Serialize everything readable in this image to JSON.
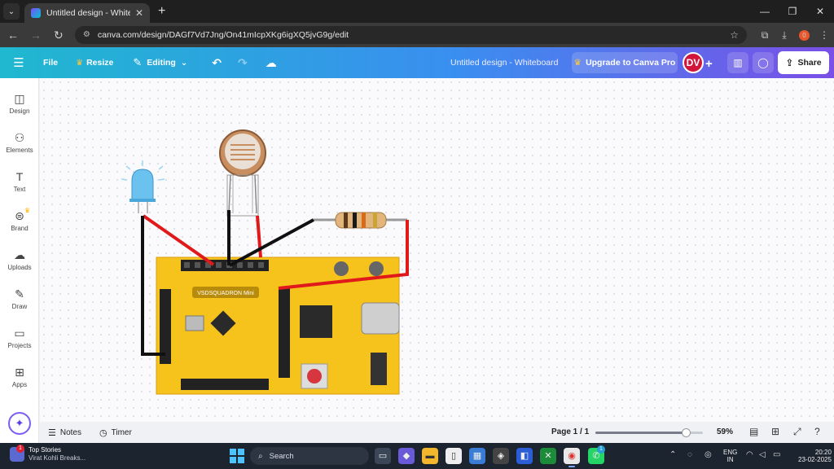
{
  "browser": {
    "tab_title": "Untitled design - Whiteboard",
    "tab_close": "✕",
    "new_tab": "+",
    "url": "canva.com/design/DAGf7Vd7Jng/On41mIcpXKg6igXQ5jvG9g/edit",
    "profile_initial": "0"
  },
  "toolbar": {
    "file": "File",
    "resize": "Resize",
    "editing": "Editing",
    "doc_title": "Untitled design - Whiteboard",
    "upgrade": "Upgrade to Canva Pro",
    "avatar_initials": "DV",
    "share": "Share"
  },
  "sidebar": {
    "items": [
      {
        "label": "Design",
        "icon": "design-icon"
      },
      {
        "label": "Elements",
        "icon": "elements-icon"
      },
      {
        "label": "Text",
        "icon": "text-icon"
      },
      {
        "label": "Brand",
        "icon": "brand-icon"
      },
      {
        "label": "Uploads",
        "icon": "uploads-icon"
      },
      {
        "label": "Draw",
        "icon": "draw-icon"
      },
      {
        "label": "Projects",
        "icon": "projects-icon"
      },
      {
        "label": "Apps",
        "icon": "apps-icon"
      }
    ]
  },
  "canvas": {
    "board_label": "VSDSQUADRON Mini",
    "wire_colors": {
      "red": "#e0191b",
      "black": "#101010"
    },
    "board_color": "#f6c21c"
  },
  "bottombar": {
    "notes": "Notes",
    "timer": "Timer",
    "page": "Page 1 / 1",
    "zoom": "59%",
    "zoom_fraction": 0.59
  },
  "taskbar": {
    "news_title": "Top Stories",
    "news_sub": "Virat Kohli Breaks...",
    "news_badge": "1",
    "search": "Search",
    "lang_1": "ENG",
    "lang_2": "IN",
    "time": "20:20",
    "date": "23-02-2025",
    "whatsapp_badge": "1"
  }
}
